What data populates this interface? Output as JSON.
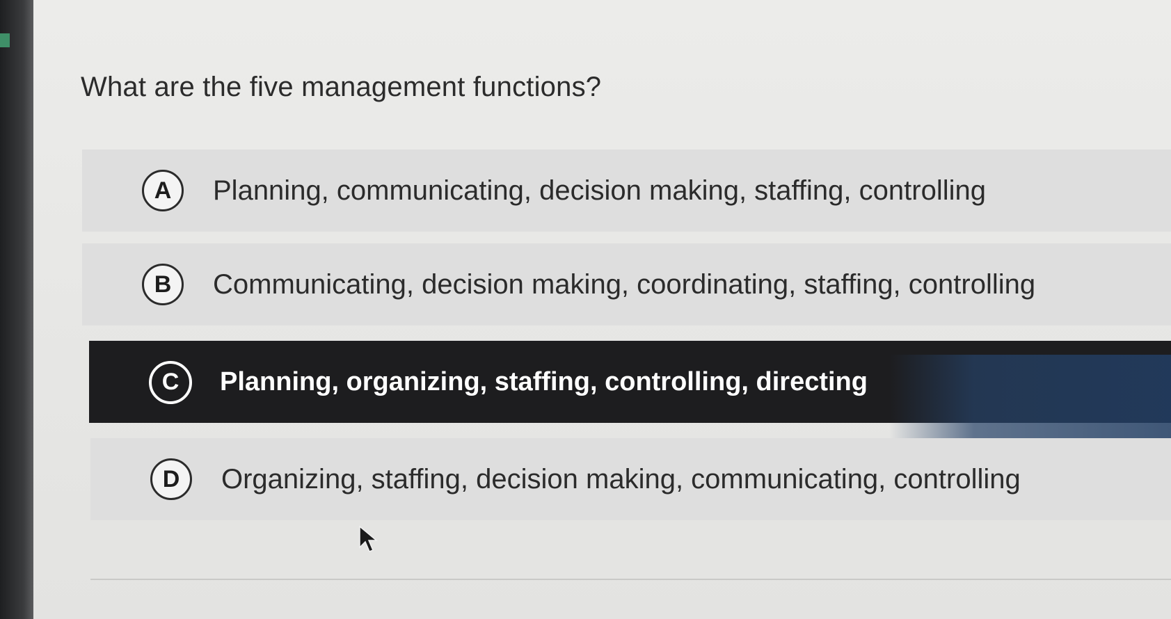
{
  "question": {
    "text": "What are the five management functions?"
  },
  "options": [
    {
      "letter": "A",
      "text": "Planning, communicating, decision making, staffing, controlling",
      "selected": false
    },
    {
      "letter": "B",
      "text": "Communicating, decision making, coordinating, staffing, controlling",
      "selected": false
    },
    {
      "letter": "C",
      "text": "Planning, organizing, staffing, controlling, directing",
      "selected": true
    },
    {
      "letter": "D",
      "text": "Organizing, staffing, decision making, communicating, controlling",
      "selected": false
    }
  ],
  "colors": {
    "selected_background": "#1d1d1f",
    "option_background": "#dedede",
    "page_background": "#ececea",
    "text": "#2b2b2b"
  },
  "icons": {
    "cursor": "mouse-pointer-icon"
  }
}
